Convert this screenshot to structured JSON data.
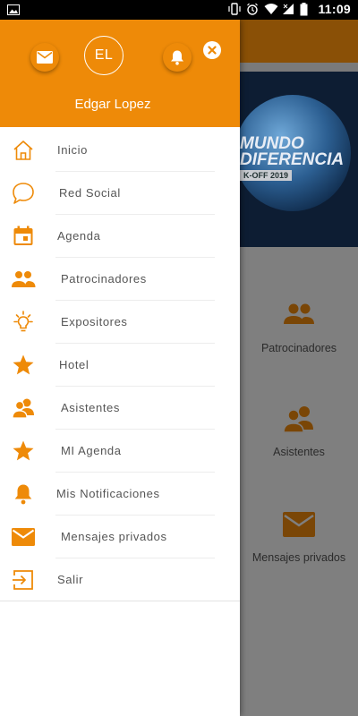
{
  "status_bar": {
    "time": "11:09",
    "icons": [
      "image-icon",
      "vibrate-icon",
      "alarm-icon",
      "wifi-icon",
      "signal-icon",
      "battery-icon"
    ]
  },
  "background_app": {
    "banner_line1": "MUNDO",
    "banner_line2": "DIFERENCIA",
    "banner_line3": "K-OFF 2019",
    "items": [
      {
        "label": "Patrocinadores",
        "icon": "group-icon"
      },
      {
        "label": "Asistentes",
        "icon": "attendees-icon"
      },
      {
        "label": "Mensajes privados",
        "icon": "mail-icon"
      }
    ]
  },
  "drawer": {
    "avatar_initials": "EL",
    "user_name": "Edgar Lopez",
    "menu": [
      {
        "label": "Inicio",
        "icon": "home-icon"
      },
      {
        "label": "Red Social",
        "icon": "chat-bubble-icon"
      },
      {
        "label": "Agenda",
        "icon": "calendar-icon"
      },
      {
        "label": "Patrocinadores",
        "icon": "group-icon"
      },
      {
        "label": "Expositores",
        "icon": "lightbulb-icon"
      },
      {
        "label": "Hotel",
        "icon": "star-icon"
      },
      {
        "label": "Asistentes",
        "icon": "attendees-icon"
      },
      {
        "label": "MI Agenda",
        "icon": "star-icon"
      },
      {
        "label": "Mis Notificaciones",
        "icon": "bell-icon"
      },
      {
        "label": "Mensajes privados",
        "icon": "mail-icon"
      },
      {
        "label": "Salir",
        "icon": "logout-icon"
      }
    ]
  },
  "colors": {
    "accent": "#ee8a08",
    "drawer_bg": "#ffffff",
    "scrim": "#7a7a7a"
  }
}
